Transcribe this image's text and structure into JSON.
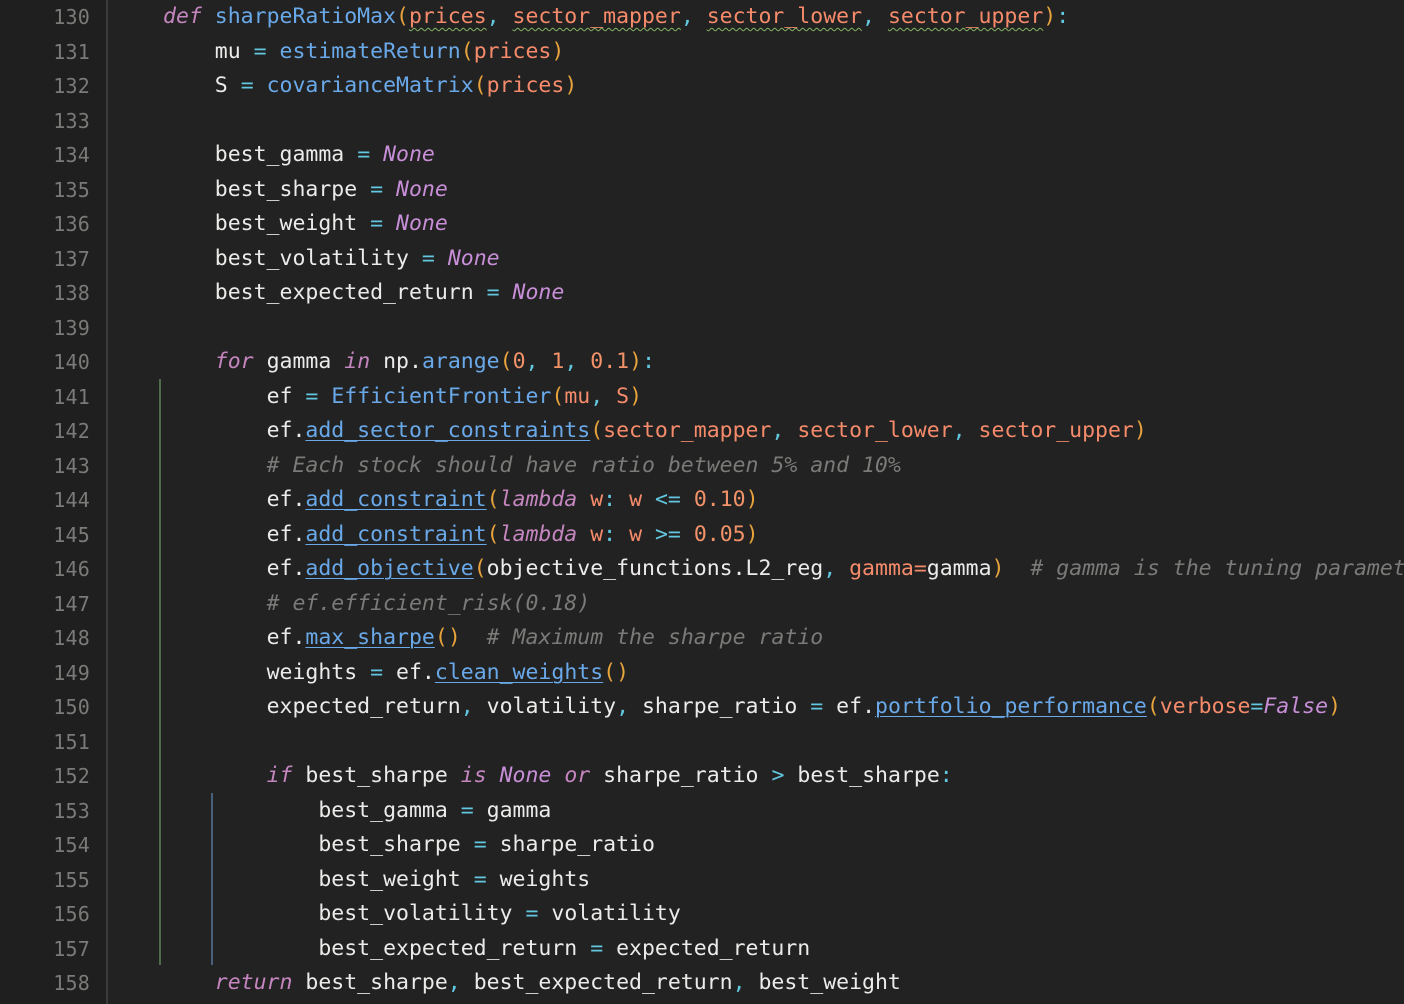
{
  "editor": {
    "language": "python",
    "theme": "dark",
    "colors": {
      "background": "#222222",
      "gutter_background": "#1f1f1f",
      "line_number": "#7a7a78",
      "keyword": "#c586c0",
      "constant": "#c88fd8",
      "function": "#6aa9e9",
      "parameter": "#f58b6a",
      "number": "#f29268",
      "bracket": "#e8a33d",
      "operator": "#62c8e0",
      "identifier": "#ecebea",
      "comment": "#7a7a78",
      "indent_guide_active": "#4e6b4a",
      "indent_guide": "#49607a",
      "spellcheck_squiggle": "#86b463"
    },
    "first_line_number": 130,
    "last_line_number": 158
  },
  "line_numbers": [
    "130",
    "131",
    "132",
    "133",
    "134",
    "135",
    "136",
    "137",
    "138",
    "139",
    "140",
    "141",
    "142",
    "143",
    "144",
    "145",
    "146",
    "147",
    "148",
    "149",
    "150",
    "151",
    "152",
    "153",
    "154",
    "155",
    "156",
    "157",
    "158"
  ],
  "code_lines": [
    {
      "number": "130",
      "text": "def sharpeRatioMax(prices, sector_mapper, sector_lower, sector_upper):"
    },
    {
      "number": "131",
      "text": "    mu = estimateReturn(prices)"
    },
    {
      "number": "132",
      "text": "    S = covarianceMatrix(prices)"
    },
    {
      "number": "133",
      "text": ""
    },
    {
      "number": "134",
      "text": "    best_gamma = None"
    },
    {
      "number": "135",
      "text": "    best_sharpe = None"
    },
    {
      "number": "136",
      "text": "    best_weight = None"
    },
    {
      "number": "137",
      "text": "    best_volatility = None"
    },
    {
      "number": "138",
      "text": "    best_expected_return = None"
    },
    {
      "number": "139",
      "text": ""
    },
    {
      "number": "140",
      "text": "    for gamma in np.arange(0, 1, 0.1):"
    },
    {
      "number": "141",
      "text": "        ef = EfficientFrontier(mu, S)"
    },
    {
      "number": "142",
      "text": "        ef.add_sector_constraints(sector_mapper, sector_lower, sector_upper)"
    },
    {
      "number": "143",
      "text": "        # Each stock should have ratio between 5% and 10%"
    },
    {
      "number": "144",
      "text": "        ef.add_constraint(lambda w: w <= 0.10)"
    },
    {
      "number": "145",
      "text": "        ef.add_constraint(lambda w: w >= 0.05)"
    },
    {
      "number": "146",
      "text": "        ef.add_objective(objective_functions.L2_reg, gamma=gamma)  # gamma is the tuning parameter"
    },
    {
      "number": "147",
      "text": "        # ef.efficient_risk(0.18)"
    },
    {
      "number": "148",
      "text": "        ef.max_sharpe()  # Maximum the sharpe ratio"
    },
    {
      "number": "149",
      "text": "        weights = ef.clean_weights()"
    },
    {
      "number": "150",
      "text": "        expected_return, volatility, sharpe_ratio = ef.portfolio_performance(verbose=False)"
    },
    {
      "number": "151",
      "text": ""
    },
    {
      "number": "152",
      "text": "        if best_sharpe is None or sharpe_ratio > best_sharpe:"
    },
    {
      "number": "153",
      "text": "            best_gamma = gamma"
    },
    {
      "number": "154",
      "text": "            best_sharpe = sharpe_ratio"
    },
    {
      "number": "155",
      "text": "            best_weight = weights"
    },
    {
      "number": "156",
      "text": "            best_volatility = volatility"
    },
    {
      "number": "157",
      "text": "            best_expected_return = expected_return"
    },
    {
      "number": "158",
      "text": "    return best_sharpe, best_expected_return, best_weight"
    }
  ],
  "tokens": {
    "l130": {
      "kw_def": "def",
      "fn_name": "sharpeRatioMax",
      "open_paren": "(",
      "p1": "prices",
      "c1": ", ",
      "p2": "sector_mapper",
      "c2": ", ",
      "p3": "sector_lower",
      "c3": ", ",
      "p4": "sector_upper",
      "close_paren": ")",
      "colon": ":"
    },
    "l131": {
      "var": "mu",
      "eq": "=",
      "fn": "estimateReturn",
      "open": "(",
      "arg": "prices",
      "close": ")"
    },
    "l132": {
      "var": "S",
      "eq": "=",
      "fn": "covarianceMatrix",
      "open": "(",
      "arg": "prices",
      "close": ")"
    },
    "l134": {
      "var": "best_gamma",
      "eq": "=",
      "val": "None"
    },
    "l135": {
      "var": "best_sharpe",
      "eq": "=",
      "val": "None"
    },
    "l136": {
      "var": "best_weight",
      "eq": "=",
      "val": "None"
    },
    "l137": {
      "var": "best_volatility",
      "eq": "=",
      "val": "None"
    },
    "l138": {
      "var": "best_expected_return",
      "eq": "=",
      "val": "None"
    },
    "l140": {
      "kw_for": "for",
      "loopvar": "gamma",
      "kw_in": "in",
      "mod": "np",
      "dot": ".",
      "fn": "arange",
      "open": "(",
      "n1": "0",
      "c1": ", ",
      "n2": "1",
      "c2": ", ",
      "n3": "0.1",
      "close": ")",
      "colon": ":"
    },
    "l141": {
      "var": "ef",
      "eq": "=",
      "cls": "EfficientFrontier",
      "open": "(",
      "a1": "mu",
      "c1": ", ",
      "a2": "S",
      "close": ")"
    },
    "l142": {
      "obj": "ef",
      "dot": ".",
      "fn": "add_sector_constraints",
      "open": "(",
      "a1": "sector_mapper",
      "c1": ", ",
      "a2": "sector_lower",
      "c2": ", ",
      "a3": "sector_upper",
      "close": ")"
    },
    "l143": {
      "comment": "# Each stock should have ratio between 5% and 10%"
    },
    "l144": {
      "obj": "ef",
      "dot": ".",
      "fn": "add_constraint",
      "open": "(",
      "kw": "lambda",
      "arg": "w",
      "colon": ":",
      "w": "w",
      "op": "<=",
      "num": "0.10",
      "close": ")"
    },
    "l145": {
      "obj": "ef",
      "dot": ".",
      "fn": "add_constraint",
      "open": "(",
      "kw": "lambda",
      "arg": "w",
      "colon": ":",
      "w": "w",
      "op": ">=",
      "num": "0.05",
      "close": ")"
    },
    "l146": {
      "obj": "ef",
      "dot": ".",
      "fn": "add_objective",
      "open": "(",
      "mod": "objective_functions",
      "dot2": ".",
      "attr": "L2_reg",
      "c1": ", ",
      "kwname": "gamma",
      "eq": "=",
      "kwval": "gamma",
      "close": ")",
      "comment": "# gamma is the tuning parameter"
    },
    "l147": {
      "comment": "# ef.efficient_risk(0.18)"
    },
    "l148": {
      "obj": "ef",
      "dot": ".",
      "fn": "max_sharpe",
      "open": "(",
      "close": ")",
      "comment": "# Maximum the sharpe ratio"
    },
    "l149": {
      "var": "weights",
      "eq": "=",
      "obj": "ef",
      "dot": ".",
      "fn": "clean_weights",
      "open": "(",
      "close": ")"
    },
    "l150": {
      "v1": "expected_return",
      "c1": ", ",
      "v2": "volatility",
      "c2": ", ",
      "v3": "sharpe_ratio",
      "eq": "=",
      "obj": "ef",
      "dot": ".",
      "fn": "portfolio_performance",
      "open": "(",
      "kwname": "verbose",
      "kweq": "=",
      "kwval": "False",
      "close": ")"
    },
    "l152": {
      "kw_if": "if",
      "v1": "best_sharpe",
      "kw_is": "is",
      "none": "None",
      "kw_or": "or",
      "v2": "sharpe_ratio",
      "op": ">",
      "v3": "best_sharpe",
      "colon": ":"
    },
    "l153": {
      "var": "best_gamma",
      "eq": "=",
      "val": "gamma"
    },
    "l154": {
      "var": "best_sharpe",
      "eq": "=",
      "val": "sharpe_ratio"
    },
    "l155": {
      "var": "best_weight",
      "eq": "=",
      "val": "weights"
    },
    "l156": {
      "var": "best_volatility",
      "eq": "=",
      "val": "volatility"
    },
    "l157": {
      "var": "best_expected_return",
      "eq": "=",
      "val": "expected_return"
    },
    "l158": {
      "kw_return": "return",
      "v1": "best_sharpe",
      "c1": ", ",
      "v2": "best_expected_return",
      "c2": ", ",
      "v3": "best_weight"
    }
  }
}
